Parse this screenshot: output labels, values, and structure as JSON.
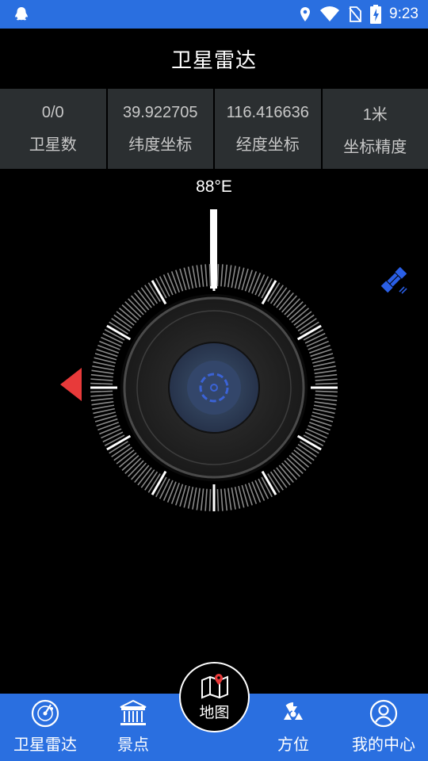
{
  "status_bar": {
    "time": "9:23",
    "icons": [
      "qq-icon",
      "location-icon",
      "wifi-icon",
      "no-sim-icon",
      "battery-charging-icon"
    ]
  },
  "header": {
    "title": "卫星雷达"
  },
  "stats": [
    {
      "value": "0/0",
      "label": "卫星数"
    },
    {
      "value": "39.922705",
      "label": "纬度坐标"
    },
    {
      "value": "116.416636",
      "label": "经度坐标"
    },
    {
      "value": "1米",
      "label": "坐标精度"
    }
  ],
  "compass": {
    "heading": "88°E",
    "heading_degrees": 88,
    "pointer_color": "#e83a3a"
  },
  "bottom_nav": {
    "items": [
      {
        "label": "卫星雷达",
        "icon": "radar-icon"
      },
      {
        "label": "景点",
        "icon": "landmark-icon"
      },
      {
        "label": "地图",
        "icon": "map-icon"
      },
      {
        "label": "方位",
        "icon": "radiation-icon"
      },
      {
        "label": "我的中心",
        "icon": "user-icon"
      }
    ]
  },
  "colors": {
    "accent": "#2a6fe0",
    "background": "#000000",
    "stat_panel": "#2b2f31"
  }
}
